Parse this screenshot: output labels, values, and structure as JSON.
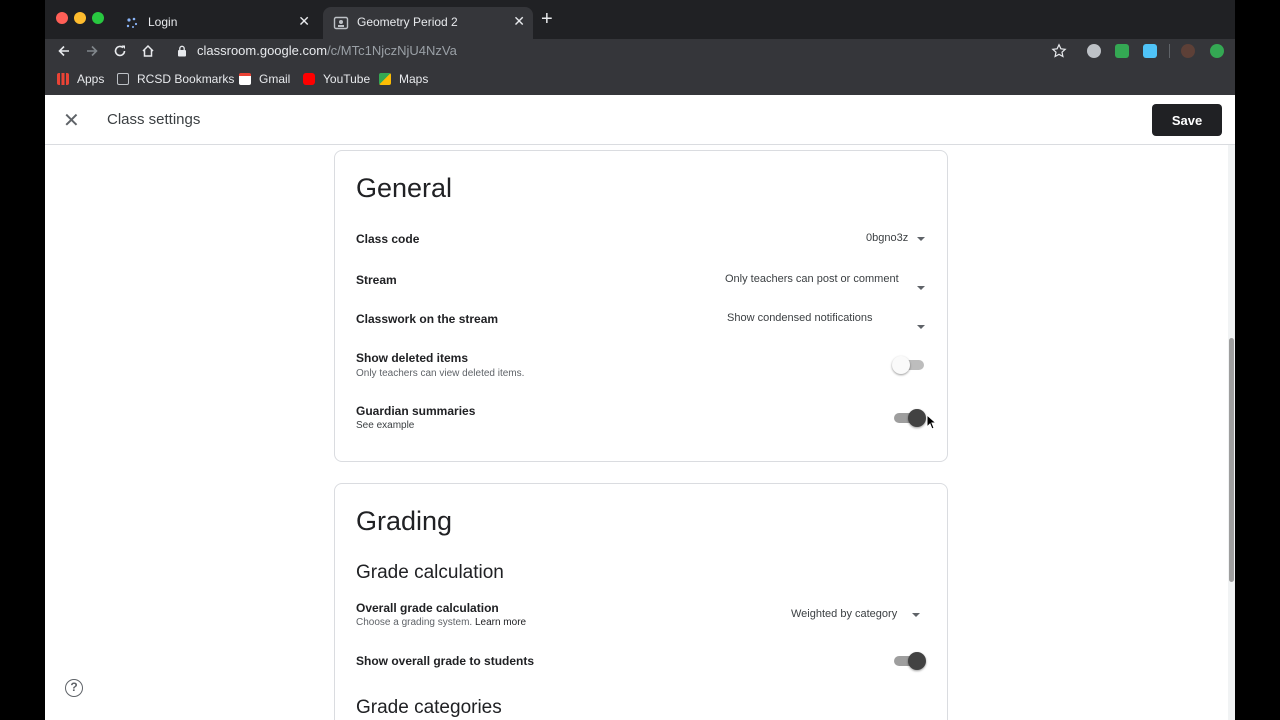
{
  "browser": {
    "tabs": [
      {
        "title": "Login",
        "close": "✕"
      },
      {
        "title": "Geometry Period 2",
        "close": "✕"
      }
    ],
    "new_tab": "+",
    "url": {
      "host": "classroom.google.com",
      "path": "/c/MTc1NjczNjU4NzVa"
    },
    "bookmarks": [
      {
        "label": "Apps",
        "icon": "apps-grid-icon",
        "color": "#e8453c"
      },
      {
        "label": "RCSD Bookmarks",
        "icon": "folder-icon",
        "color": "#9aa0a6"
      },
      {
        "label": "Gmail",
        "icon": "gmail-icon",
        "color": "#ea4335"
      },
      {
        "label": "YouTube",
        "icon": "youtube-icon",
        "color": "#ff0000"
      },
      {
        "label": "Maps",
        "icon": "maps-icon",
        "color": "#34a853"
      }
    ]
  },
  "header": {
    "close_glyph": "✕",
    "title": "Class settings",
    "save_label": "Save"
  },
  "general": {
    "heading": "General",
    "class_code": {
      "label": "Class code",
      "value": "0bgno3z"
    },
    "stream": {
      "label": "Stream",
      "value": "Only teachers can post or comment"
    },
    "classwork_on_stream": {
      "label": "Classwork on the stream",
      "value": "Show condensed notifications"
    },
    "show_deleted": {
      "label": "Show deleted items",
      "sub": "Only teachers can view deleted items.",
      "enabled": false
    },
    "guardian_summaries": {
      "label": "Guardian summaries",
      "sub": "See example",
      "enabled": true
    }
  },
  "grading": {
    "heading": "Grading",
    "grade_calculation_heading": "Grade calculation",
    "overall_grade": {
      "label": "Overall grade calculation",
      "sub": "Choose a grading system.",
      "link": "Learn more",
      "value": "Weighted by category"
    },
    "show_overall": {
      "label": "Show overall grade to students",
      "enabled": true
    },
    "grade_categories_heading": "Grade categories"
  },
  "help_glyph": "?",
  "colors": {
    "accent": "#202124",
    "chrome_dark": "#202124",
    "chrome_mid": "#35363a"
  }
}
